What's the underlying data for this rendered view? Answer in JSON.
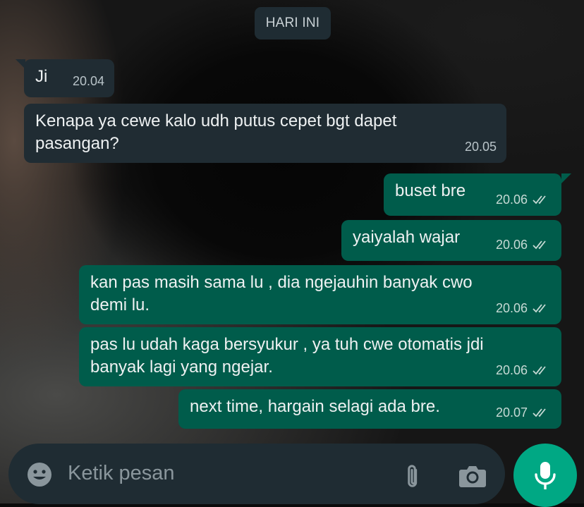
{
  "date_chip": "HARI INI",
  "messages": [
    {
      "dir": "in",
      "text": "Ji",
      "time": "20.04"
    },
    {
      "dir": "in",
      "text": "Kenapa ya cewe kalo udh putus cepet bgt dapet\npasangan?",
      "time": "20.05"
    },
    {
      "dir": "out",
      "text": "buset bre",
      "time": "20.06",
      "status": "delivered"
    },
    {
      "dir": "out",
      "text": "yaiyalah wajar",
      "time": "20.06",
      "status": "delivered"
    },
    {
      "dir": "out",
      "text": "kan pas masih sama lu , dia ngejauhin banyak cwo\ndemi lu.",
      "time": "20.06",
      "status": "delivered"
    },
    {
      "dir": "out",
      "text": "pas lu udah kaga bersyukur , ya tuh cwe otomatis jdi\nbanyak lagi yang ngejar.",
      "time": "20.06",
      "status": "delivered"
    },
    {
      "dir": "out",
      "text": "next time, hargain selagi ada bre.",
      "time": "20.07",
      "status": "delivered"
    }
  ],
  "input": {
    "placeholder": "Ketik pesan"
  },
  "icons": {
    "emoji": "smiley-icon",
    "attach": "paperclip-icon",
    "camera": "camera-icon",
    "mic": "microphone-icon",
    "ticks": "double-check-icon"
  },
  "colors": {
    "incoming_bubble": "#202c33",
    "outgoing_bubble": "#005c4b",
    "accent": "#00a884",
    "input_bar": "#1f2c33"
  }
}
